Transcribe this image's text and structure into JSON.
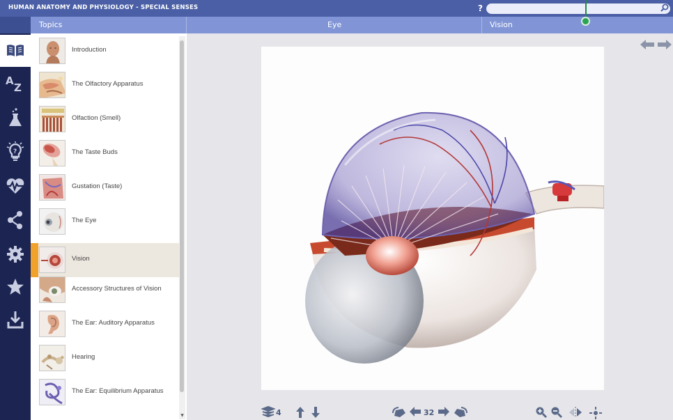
{
  "app": {
    "title": "HUMAN ANATOMY AND PHYSIOLOGY - SPECIAL SENSES",
    "help_label": "?",
    "search_placeholder": "",
    "search_value": ""
  },
  "breadcrumb": {
    "topics": "Topics",
    "section": "Eye",
    "page": "Vision"
  },
  "rail": [
    {
      "name": "book-icon",
      "active": true
    },
    {
      "name": "az-glossary-icon",
      "active": false
    },
    {
      "name": "flask-icon",
      "active": false
    },
    {
      "name": "lightbulb-icon",
      "active": false
    },
    {
      "name": "heartbeat-icon",
      "active": false
    },
    {
      "name": "share-icon",
      "active": false
    },
    {
      "name": "gear-icon",
      "active": false
    },
    {
      "name": "star-icon",
      "active": false
    },
    {
      "name": "download-icon",
      "active": false
    }
  ],
  "topics": [
    {
      "label": "Introduction"
    },
    {
      "label": "The Olfactory Apparatus"
    },
    {
      "label": "Olfaction (Smell)"
    },
    {
      "label": "The Taste Buds"
    },
    {
      "label": "Gustation (Taste)"
    },
    {
      "label": "The Eye"
    },
    {
      "label": "Vision",
      "active": true
    },
    {
      "label": "Accessory Structures of Vision"
    },
    {
      "label": "The Ear: Auditory Apparatus"
    },
    {
      "label": "Hearing"
    },
    {
      "label": "The Ear: Equilibrium Apparatus"
    }
  ],
  "toolbar": {
    "layers_count": "4",
    "page_number": "32"
  },
  "colors": {
    "title_bar": "#4a5fa6",
    "breadcrumb_bar": "#8195d6",
    "rail": "#1c2452",
    "active_accent": "#f0a22b",
    "pointer": "#2aa453"
  }
}
